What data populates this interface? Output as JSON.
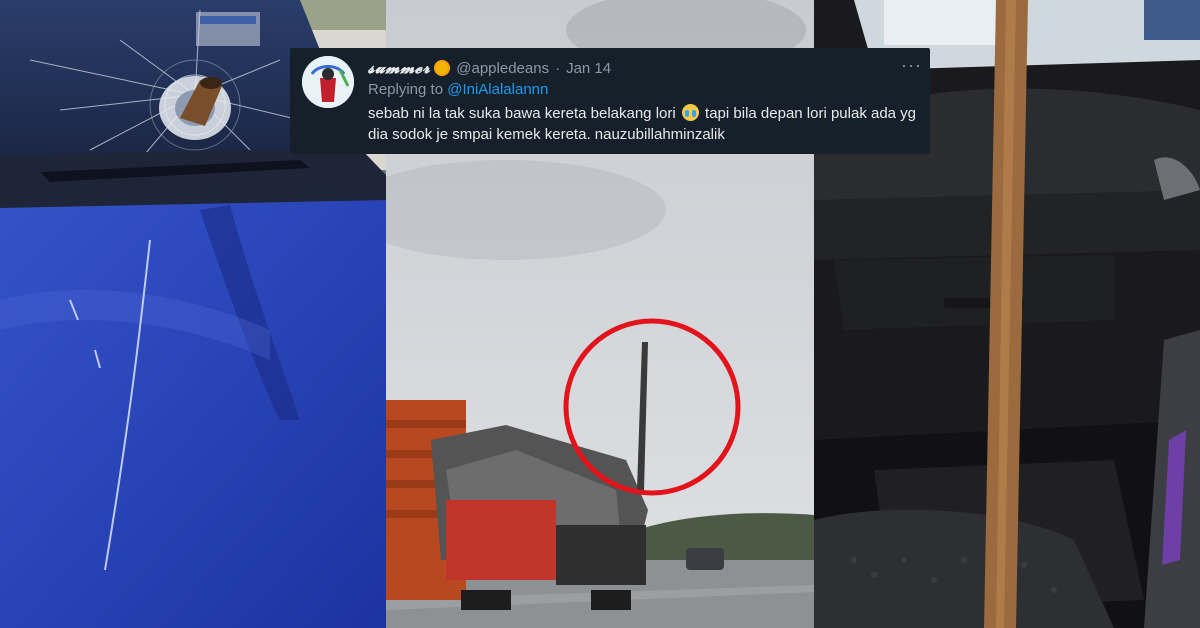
{
  "tweet": {
    "display_name": "𝓼𝓾𝓶𝓶𝓮𝓻",
    "handle": "@appledeans",
    "separator": "·",
    "date": "Jan 14",
    "replying_prefix": "Replying to",
    "replying_to": "@IniAlalalannn",
    "text_part1": "sebab ni la tak suka bawa kereta belakang lori",
    "text_part2": "tapi bila depan lori pulak ada yg dia sodok je smpai kemek kereta. nauzubillahminzalik",
    "more_label": "···",
    "emoji": "loudly-crying-face-icon"
  },
  "colors": {
    "tweet_bg": "#15202b",
    "link": "#1d9bf0",
    "circle": "#e3131b",
    "car_blue": "#2540b4"
  }
}
